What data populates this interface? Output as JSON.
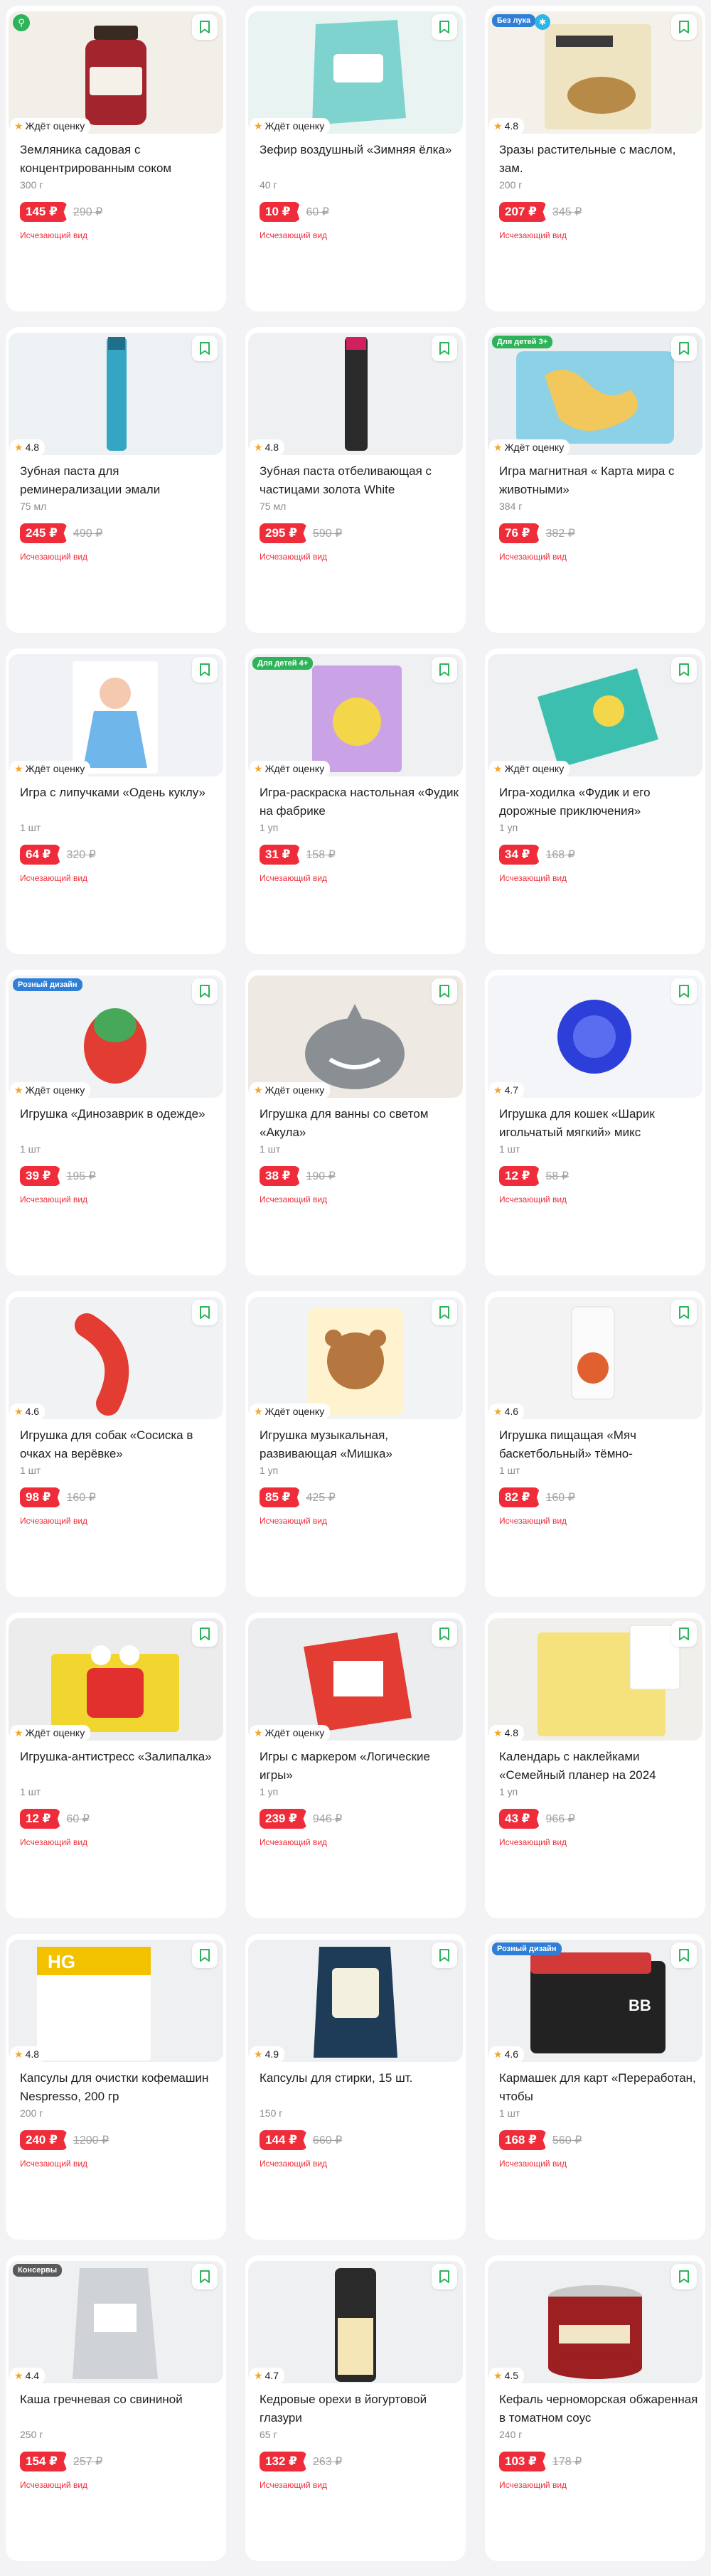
{
  "currency": "₽",
  "products": [
    {
      "title": "Земляника садовая с концентрированным соком",
      "weight": "300 г",
      "price": "145 ₽",
      "old_price": "290 ₽",
      "rating": "Ждёт оценку",
      "badge": "",
      "stock": "Исчезающий вид",
      "img": "jar"
    },
    {
      "title": "Зефир воздушный «Зимняя ёлка»",
      "weight": "40 г",
      "price": "10 ₽",
      "old_price": "60 ₽",
      "rating": "Ждёт оценку",
      "badge": "",
      "stock": "Исчезающий вид",
      "img": "pack"
    },
    {
      "title": "Зразы растительные с маслом, зам.",
      "weight": "200 г",
      "price": "207 ₽",
      "old_price": "345 ₽",
      "rating": "4.8",
      "badge": "Без лука",
      "stock": "Исчезающий вид",
      "img": "box"
    },
    {
      "title": "Зубная паста для реминерализации эмали",
      "weight": "75 мл",
      "price": "245 ₽",
      "old_price": "490 ₽",
      "rating": "4.8",
      "badge": "",
      "stock": "Исчезающий вид",
      "img": "tube_teal"
    },
    {
      "title": "Зубная паста отбеливающая с частицами золота White",
      "weight": "75 мл",
      "price": "295 ₽",
      "old_price": "590 ₽",
      "rating": "4.8",
      "badge": "",
      "stock": "Исчезающий вид",
      "img": "tube_pink"
    },
    {
      "title": "Игра магнитная « Карта мира с животными»",
      "weight": "384 г",
      "price": "76 ₽",
      "old_price": "382 ₽",
      "rating": "Ждёт оценку",
      "badge": "Для детей 3+",
      "stock": "Исчезающий вид",
      "img": "map"
    },
    {
      "title": "Игра с липучками «Одень куклу»",
      "weight": "1 шт",
      "price": "64 ₽",
      "old_price": "320 ₽",
      "rating": "Ждёт оценку",
      "badge": "",
      "stock": "Исчезающий вид",
      "img": "doll"
    },
    {
      "title": "Игра-раскраска настольная «Фудик на фабрике",
      "weight": "1 уп",
      "price": "31 ₽",
      "old_price": "158 ₽",
      "rating": "Ждёт оценку",
      "badge": "Для детей 4+",
      "stock": "Исчезающий вид",
      "img": "book_purple"
    },
    {
      "title": "Игра-ходилка «Фудик и его дорожные приключения»",
      "weight": "1 уп",
      "price": "34 ₽",
      "old_price": "168 ₽",
      "rating": "Ждёт оценку",
      "badge": "",
      "stock": "Исчезающий вид",
      "img": "book_teal"
    },
    {
      "title": "Игрушка «Динозаврик в одежде»",
      "weight": "1 шт",
      "price": "39 ₽",
      "old_price": "195 ₽",
      "rating": "Ждёт оценку",
      "badge": "Розный дизайн",
      "stock": "Исчезающий вид",
      "img": "dino"
    },
    {
      "title": "Игрушка для ванны со светом «Акула»",
      "weight": "1 шт",
      "price": "38 ₽",
      "old_price": "190 ₽",
      "rating": "Ждёт оценку",
      "badge": "",
      "stock": "Исчезающий вид",
      "img": "shark"
    },
    {
      "title": "Игрушка для кошек «Шарик игольчатый мягкий» микс",
      "weight": "1 шт",
      "price": "12 ₽",
      "old_price": "58 ₽",
      "rating": "4.7",
      "badge": "",
      "stock": "Исчезающий вид",
      "img": "spiky"
    },
    {
      "title": "Игрушка для собак «Сосиска в очках на верёвке»",
      "weight": "1 шт",
      "price": "98 ₽",
      "old_price": "160 ₽",
      "rating": "4.6",
      "badge": "",
      "stock": "Исчезающий вид",
      "img": "sausage"
    },
    {
      "title": "Игрушка музыкальная, развивающая «Мишка»",
      "weight": "1 уп",
      "price": "85 ₽",
      "old_price": "425 ₽",
      "rating": "Ждёт оценку",
      "badge": "",
      "stock": "Исчезающий вид",
      "img": "bear"
    },
    {
      "title": "Игрушка пищащая «Мяч баскетбольный» тёмно-",
      "weight": "1 шт",
      "price": "82 ₽",
      "old_price": "160 ₽",
      "rating": "4.6",
      "badge": "",
      "stock": "Исчезающий вид",
      "img": "ball"
    },
    {
      "title": "Игрушка-антистресс «Залипалка»",
      "weight": "1 шт",
      "price": "12 ₽",
      "old_price": "60 ₽",
      "rating": "Ждёт оценку",
      "badge": "",
      "stock": "Исчезающий вид",
      "img": "antistress"
    },
    {
      "title": "Игры с маркером «Логические игры»",
      "weight": "1 уп",
      "price": "239 ₽",
      "old_price": "946 ₽",
      "rating": "Ждёт оценку",
      "badge": "",
      "stock": "Исчезающий вид",
      "img": "logic"
    },
    {
      "title": "Календарь с наклейками «Семейный планер на 2024",
      "weight": "1 уп",
      "price": "43 ₽",
      "old_price": "966 ₽",
      "rating": "4.8",
      "badge": "",
      "stock": "Исчезающий вид",
      "img": "calendar"
    },
    {
      "title": "Капсулы для очистки кофемашин Nespresso, 200 гр",
      "weight": "200 г",
      "price": "240 ₽",
      "old_price": "1200 ₽",
      "rating": "4.8",
      "badge": "",
      "stock": "Исчезающий вид",
      "img": "hg"
    },
    {
      "title": "Капсулы для стирки, 15 шт.",
      "weight": "150 г",
      "price": "144 ₽",
      "old_price": "660 ₽",
      "rating": "4.9",
      "badge": "",
      "stock": "Исчезающий вид",
      "img": "capsules"
    },
    {
      "title": "Кармашек для карт «Переработан, чтобы",
      "weight": "1 шт",
      "price": "168 ₽",
      "old_price": "560 ₽",
      "rating": "4.6",
      "badge": "Розный дизайн",
      "stock": "Исчезающий вид",
      "img": "cardholder"
    },
    {
      "title": "Каша гречневая со свининой",
      "weight": "250 г",
      "price": "154 ₽",
      "old_price": "257 ₽",
      "rating": "4.4",
      "badge": "Консервы",
      "stock": "Исчезающий вид",
      "img": "porridge"
    },
    {
      "title": "Кедровые орехи в йогуртовой глазури",
      "weight": "65 г",
      "price": "132 ₽",
      "old_price": "263 ₽",
      "rating": "4.7",
      "badge": "",
      "stock": "Исчезающий вид",
      "img": "nuts"
    },
    {
      "title": "Кефаль черноморская обжаренная в томатном соус",
      "weight": "240 г",
      "price": "103 ₽",
      "old_price": "178 ₽",
      "rating": "4.5",
      "badge": "",
      "stock": "Исчезающий вид",
      "img": "can"
    }
  ]
}
